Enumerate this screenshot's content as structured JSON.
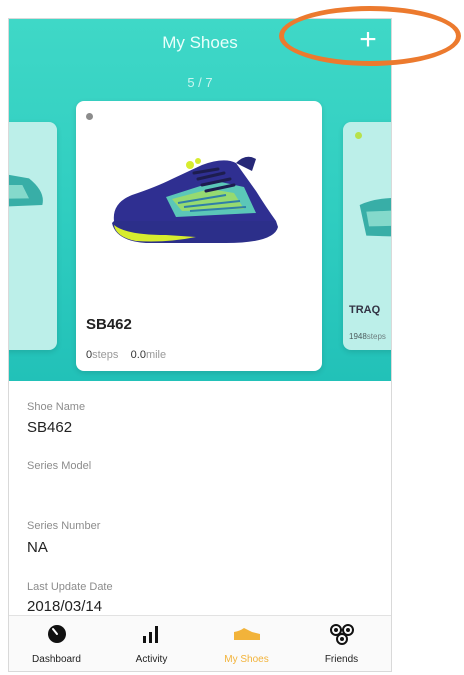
{
  "header": {
    "title": "My Shoes",
    "add_label": "+",
    "pager": "5 / 7"
  },
  "main_card": {
    "name": "SB462",
    "steps_value": "0",
    "steps_unit": "steps",
    "mile_value": "0.0",
    "mile_unit": "mile"
  },
  "next_card": {
    "name": "TRAQ",
    "steps_value": "1948",
    "steps_unit": "steps"
  },
  "details": [
    {
      "label": "Shoe Name",
      "value": "SB462"
    },
    {
      "label": "Series Model",
      "value": ""
    },
    {
      "label": "Series Number",
      "value": "NA"
    },
    {
      "label": "Last Update Date",
      "value": "2018/03/14"
    }
  ],
  "tabs": [
    {
      "label": "Dashboard",
      "icon": "gauge-icon"
    },
    {
      "label": "Activity",
      "icon": "bar-chart-icon"
    },
    {
      "label": "My Shoes",
      "icon": "shoe-icon",
      "active": true
    },
    {
      "label": "Friends",
      "icon": "friends-icon"
    }
  ],
  "colors": {
    "accent": "#2fcdc0",
    "active_tab": "#f2b33a",
    "annotation": "#ec7a2e"
  }
}
